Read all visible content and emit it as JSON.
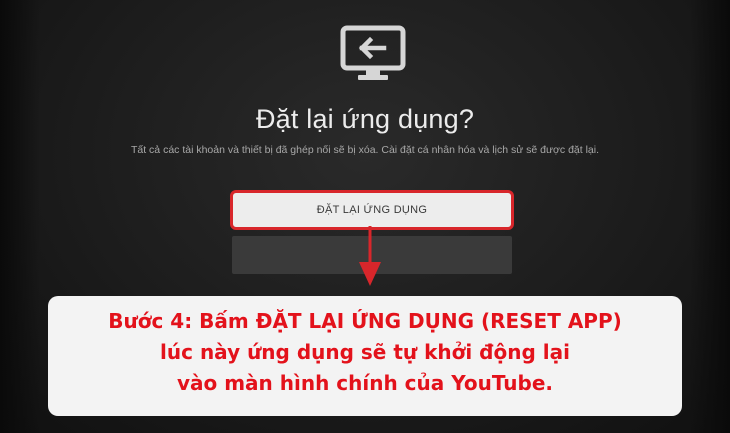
{
  "dialog": {
    "icon": "cast-reset-icon",
    "title": "Đặt lại ứng dụng?",
    "subtitle": "Tất cả các tài khoản và thiết bị đã ghép nối sẽ bị xóa. Cài đặt cá nhân hóa và lịch sử sẽ được đặt lại.",
    "reset_button_label": "ĐẶT LẠI ỨNG DỤNG",
    "cancel_button_label": ""
  },
  "annotation": {
    "highlight_color": "#d8262b",
    "text_color": "#e3121b",
    "lines": [
      "Bước 4: Bấm ĐẶT LẠI ỨNG DỤNG (RESET APP)",
      "lúc này ứng dụng sẽ tự khởi động lại",
      "vào màn hình chính của YouTube."
    ]
  }
}
